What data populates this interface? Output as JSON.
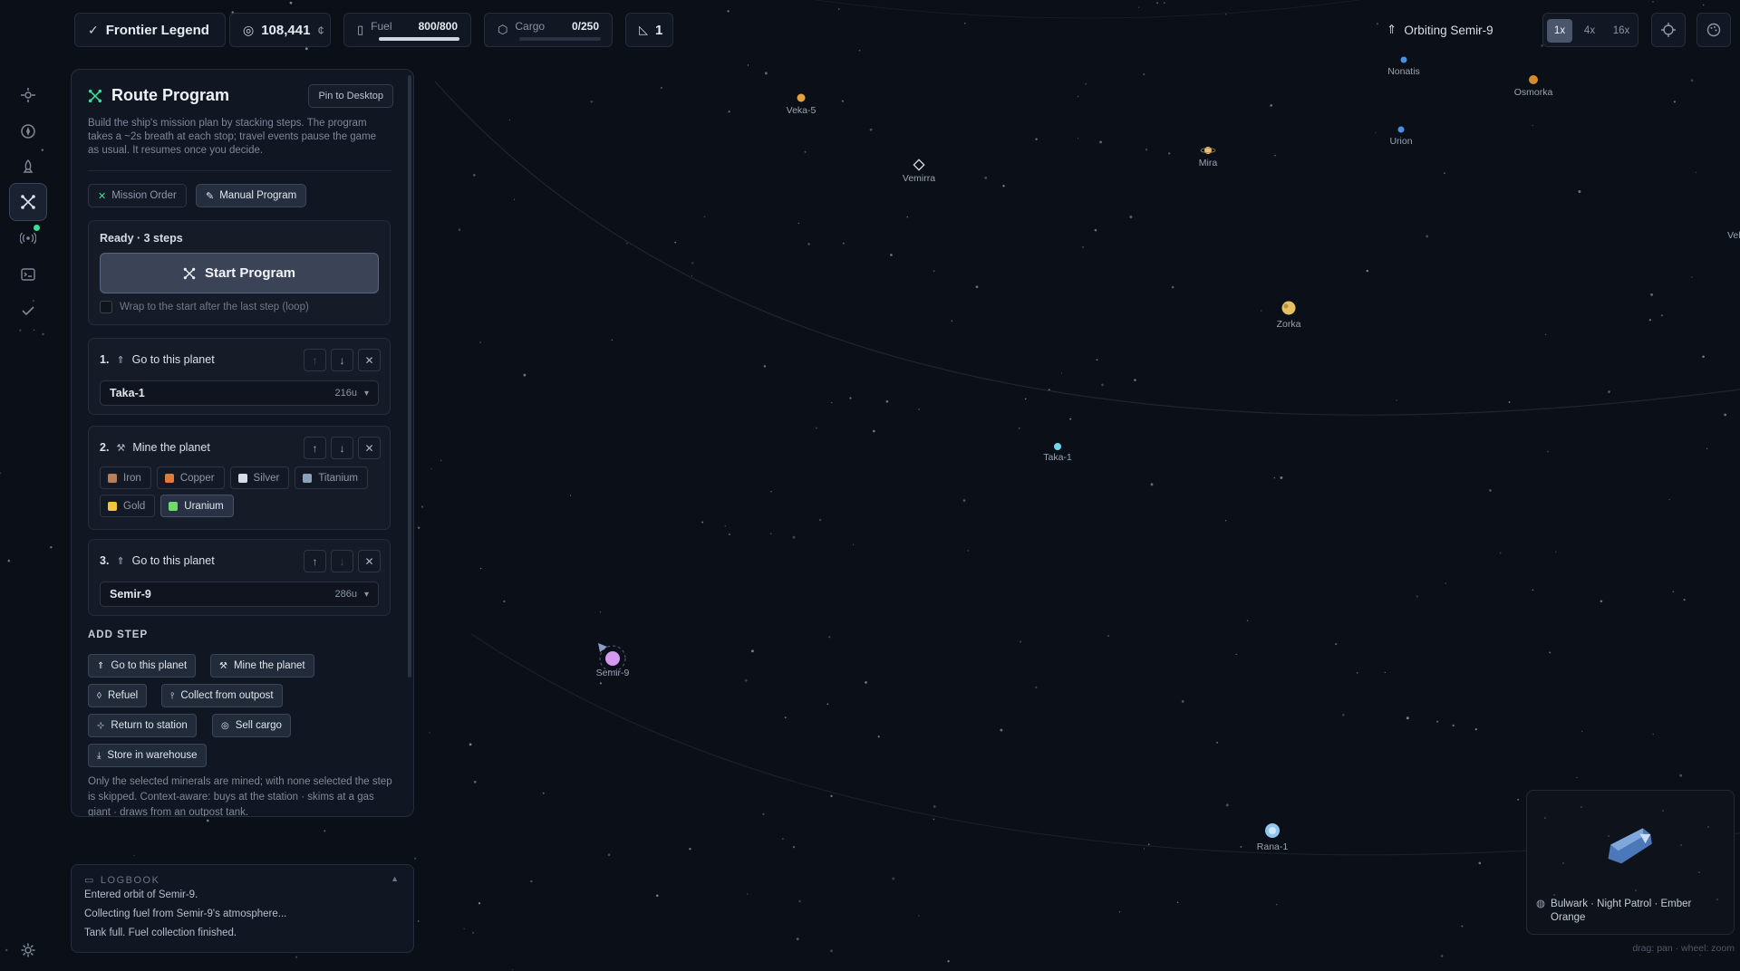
{
  "topbar": {
    "title": "Frontier Legend",
    "credits": "108,441",
    "fuel_label": "Fuel",
    "fuel_value": "800/800",
    "fuel_fraction": 1.0,
    "cargo_label": "Cargo",
    "cargo_value": "0/250",
    "cargo_fraction": 0.0,
    "ships": "1",
    "status": "Orbiting Semir-9",
    "zoom_options": [
      "1x",
      "4x",
      "16x"
    ],
    "zoom_selected": "1x"
  },
  "panel": {
    "title": "Route Program",
    "pin_label": "Pin to Desktop",
    "description": "Build the ship's mission plan by stacking steps. The program takes a ~2s breath at each stop; travel events pause the game as usual. It resumes once you decide.",
    "tabs": [
      "Mission Order",
      "Manual Program"
    ],
    "active_tab": "Manual Program",
    "ready": "Ready · 3 steps",
    "start_label": "Start Program",
    "loop_label": "Wrap to the start after the last step (loop)",
    "steps": [
      {
        "num": "1.",
        "label": "Go to this planet",
        "target": "Taka-1",
        "distance": "216u"
      },
      {
        "num": "2.",
        "label": "Mine the planet",
        "minerals": [
          {
            "name": "Iron",
            "color": "#b8805a",
            "selected": false
          },
          {
            "name": "Copper",
            "color": "#e27a3a",
            "selected": false
          },
          {
            "name": "Silver",
            "color": "#d9dee6",
            "selected": false
          },
          {
            "name": "Titanium",
            "color": "#8aa3b8",
            "selected": false
          },
          {
            "name": "Gold",
            "color": "#f2c53d",
            "selected": false
          },
          {
            "name": "Uranium",
            "color": "#6fdc6a",
            "selected": true
          }
        ]
      },
      {
        "num": "3.",
        "label": "Go to this planet",
        "target": "Semir-9",
        "distance": "286u"
      }
    ],
    "add_step_heading": "ADD STEP",
    "add_step_buttons": [
      "Go to this planet",
      "Mine the planet",
      "Refuel",
      "Collect from outpost",
      "Return to station",
      "Sell cargo",
      "Store in warehouse"
    ],
    "note": "Only the selected minerals are mined; with none selected the step is skipped. Context-aware: buys at the station · skims at a gas giant · draws from an outpost tank."
  },
  "logbook": {
    "heading": "LOGBOOK",
    "lines": [
      "Entered orbit of Semir-9.",
      "Collecting fuel from Semir-9's atmosphere...",
      "Tank full. Fuel collection finished."
    ]
  },
  "map": {
    "planets": [
      {
        "name": "Veka-5",
        "color": "#e3a23b"
      },
      {
        "name": "Vemirra",
        "color": "#d7dde6"
      },
      {
        "name": "Mira",
        "color": "#e8c070"
      },
      {
        "name": "Nonatis",
        "color": "#4a8fe0"
      },
      {
        "name": "Urion",
        "color": "#4a8fe0"
      },
      {
        "name": "Osmorka",
        "color": "#d68a2e"
      },
      {
        "name": "Vel",
        "color": "#9aa4b3"
      },
      {
        "name": "Zorka",
        "color": "#e6c062"
      },
      {
        "name": "Taka-1",
        "color": "#6fd6f2"
      },
      {
        "name": "Semir-9",
        "color": "#d39af0"
      },
      {
        "name": "Rana-1",
        "color": "#8fc7f0"
      }
    ]
  },
  "minimap": {
    "caption": "Bulwark · Night Patrol · Ember Orange"
  },
  "hint": "drag: pan · wheel: zoom"
}
